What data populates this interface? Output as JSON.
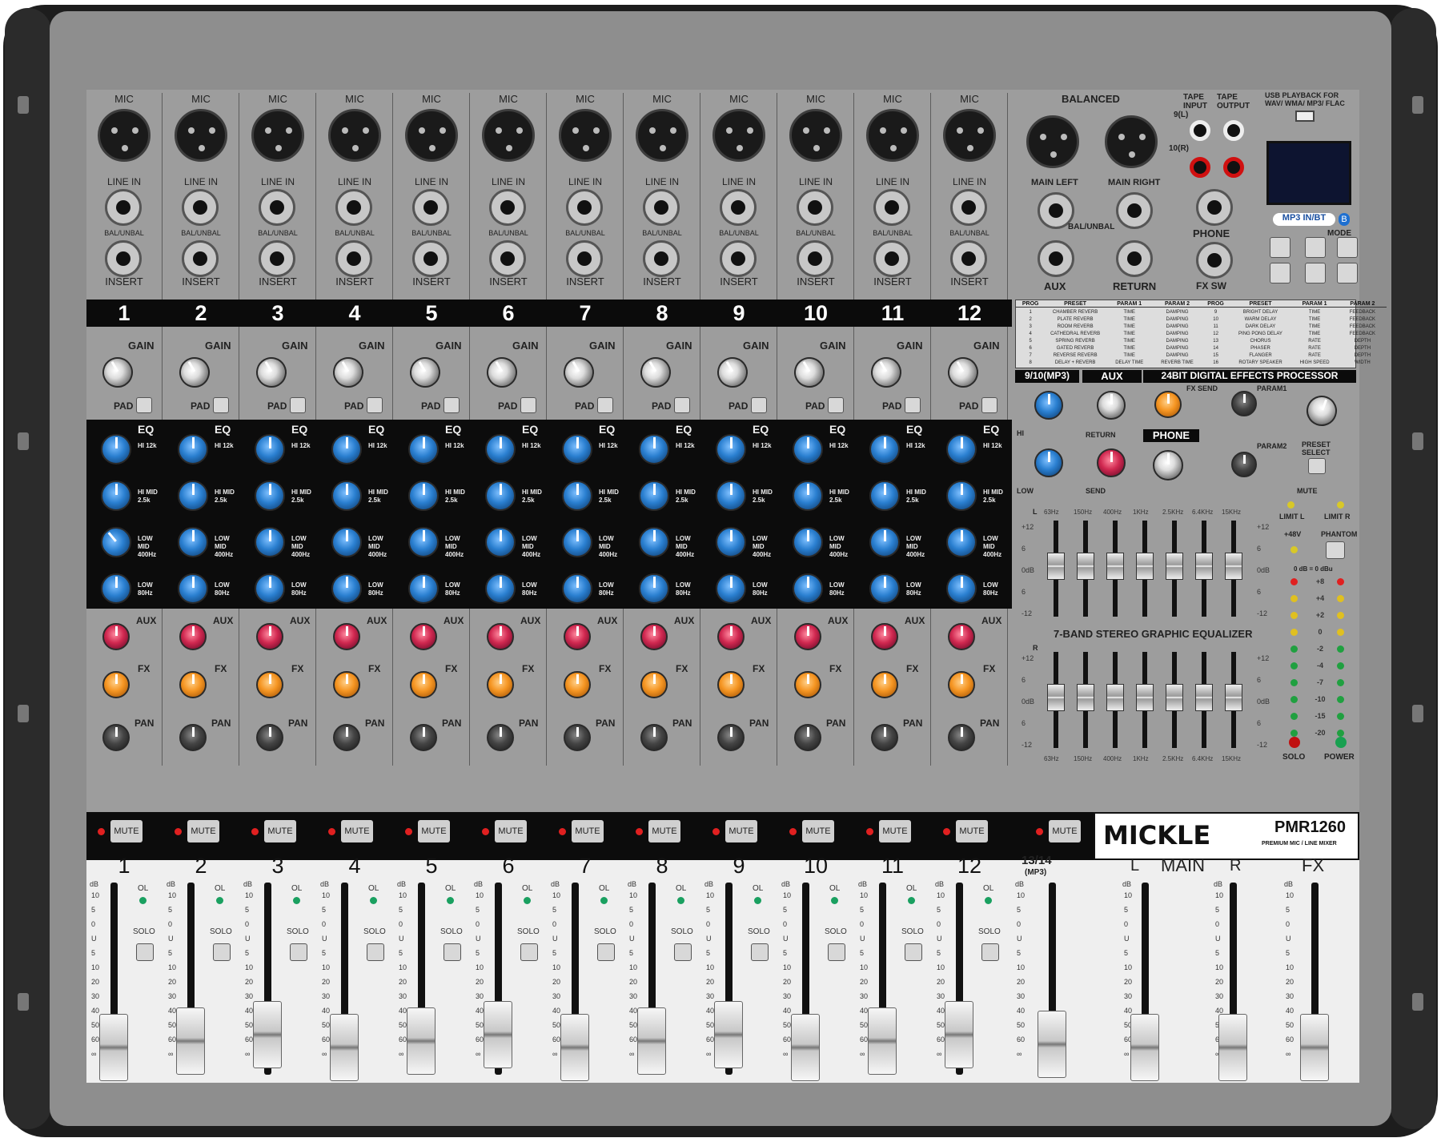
{
  "brand": {
    "name": "MICKLE",
    "model": "PMR1260",
    "tagline": "PREMIUM  MIC / LINE MIXER"
  },
  "channels": [
    "1",
    "2",
    "3",
    "4",
    "5",
    "6",
    "7",
    "8",
    "9",
    "10",
    "11",
    "12"
  ],
  "input_labels": {
    "mic": "MIC",
    "line_in": "LINE IN",
    "bal_unbal": "BAL/UNBAL",
    "insert": "INSERT"
  },
  "strip_labels": {
    "gain": "GAIN",
    "pad": "PAD",
    "eq": "EQ",
    "hi": "HI 12k",
    "hi_mid": "HI MID 2.5k",
    "low_mid": "LOW MID 400Hz",
    "low": "LOW 80Hz",
    "aux": "AUX",
    "fx": "FX",
    "pan": "PAN"
  },
  "master_inputs": {
    "balanced": "BALANCED",
    "main_left": "MAIN LEFT",
    "main_right": "MAIN RIGHT",
    "bal_unbal": "BAL/UNBAL",
    "aux": "AUX",
    "return": "RETURN",
    "tape_input": "TAPE INPUT",
    "tape_output": "TAPE OUTPUT",
    "ch9": "9(L)",
    "ch10": "10(R)",
    "phone": "PHONE",
    "fx_sw": "FX SW",
    "usb_note": "USB PLAYBACK FOR WAV/ WMA/ MP3/ FLAC",
    "mp3_bt": "MP3 IN/BT",
    "mode": "MODE"
  },
  "effects_table": {
    "headers": [
      "PROG",
      "PRESET",
      "PARAM 1",
      "PARAM 2",
      "PROG",
      "PRESET",
      "PARAM 1",
      "PARAM 2"
    ],
    "rows": [
      [
        "1",
        "CHAMBER REVERB",
        "TIME",
        "DAMPING",
        "9",
        "BRIGHT DELAY",
        "TIME",
        "FEEDBACK"
      ],
      [
        "2",
        "PLATE REVERB",
        "TIME",
        "DAMPING",
        "10",
        "WARM DELAY",
        "TIME",
        "FEEDBACK"
      ],
      [
        "3",
        "ROOM REVERB",
        "TIME",
        "DAMPING",
        "11",
        "DARK DELAY",
        "TIME",
        "FEEDBACK"
      ],
      [
        "4",
        "CATHEDRAL REVERB",
        "TIME",
        "DAMPING",
        "12",
        "PING PONG DELAY",
        "TIME",
        "FEEDBACK"
      ],
      [
        "5",
        "SPRING REVERB",
        "TIME",
        "DAMPING",
        "13",
        "CHORUS",
        "RATE",
        "DEPTH"
      ],
      [
        "6",
        "GATED REVERB",
        "TIME",
        "DAMPING",
        "14",
        "PHASER",
        "RATE",
        "DEPTH"
      ],
      [
        "7",
        "REVERSE REVERB",
        "TIME",
        "DAMPING",
        "15",
        "FLANGER",
        "RATE",
        "DEPTH"
      ],
      [
        "8",
        "DELAY + REVERB",
        "DELAY TIME",
        "REVERB TIME",
        "16",
        "ROTARY SPEAKER",
        "HIGH SPEED",
        "WIDTH"
      ]
    ]
  },
  "sections": {
    "mp3": "9/10(MP3)",
    "aux": "AUX",
    "fx": "24BIT DIGITAL EFFECTS PROCESSOR",
    "phone": "PHONE",
    "fx_send": "FX SEND",
    "param1": "PARAM1",
    "param2": "PARAM2",
    "preset_select": "PRESET SELECT",
    "mute": "MUTE",
    "hi": "HI",
    "low": "LOW",
    "return": "RETURN",
    "send": "SEND"
  },
  "geq": {
    "title": "7-BAND STEREO GRAPHIC EQUALIZER",
    "bands": [
      "63Hz",
      "150Hz",
      "400Hz",
      "1KHz",
      "2.5KHz",
      "6.4KHz",
      "15KHz"
    ],
    "scale": [
      "+12",
      "6",
      "0dB",
      "6",
      "-12"
    ],
    "left": "L",
    "right": "R"
  },
  "meter": {
    "limit_l": "LIMIT L",
    "limit_r": "LIMIT R",
    "phantom_v": "+48V",
    "phantom": "PHANTOM",
    "ref": "0 dB = 0 dBu",
    "levels": [
      "+8",
      "+4",
      "+2",
      "0",
      "-2",
      "-4",
      "-7",
      "-10",
      "-15",
      "-20"
    ],
    "solo": "SOLO",
    "power": "POWER"
  },
  "fader": {
    "mute": "MUTE",
    "ol": "OL",
    "solo": "SOLO",
    "db": "dB",
    "scale": [
      "10",
      "5",
      "0",
      "U",
      "5",
      "10",
      "20",
      "30",
      "40",
      "50",
      "60",
      "∞"
    ],
    "ch13": "13/14",
    "mp3": "(MP3)",
    "main": "MAIN",
    "l": "L",
    "r": "R",
    "fx": "FX"
  }
}
